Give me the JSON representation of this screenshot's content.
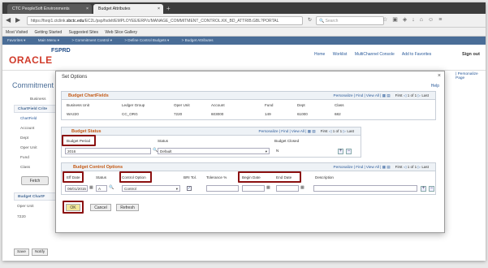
{
  "browser": {
    "tabs": [
      {
        "label": "CTC PeopleSoft Environments"
      },
      {
        "label": "Budget Attributes"
      }
    ],
    "url_prefix": "https://fsrqi1.ctclink.",
    "url_domain": "sbctc.edu",
    "url_suffix": "/EC2L/psp/fsdvlt/EMPLOYEE/ERP/c/MANAGE_COMMITMENT_CONTROL.KK_BD_ATTRIB.GBL?PORTAL",
    "search_placeholder": "Search",
    "bookmarks": [
      "Most Visited",
      "Getting Started",
      "Suggested Sites",
      "Web Slice Gallery"
    ]
  },
  "ps": {
    "menu": [
      "Favorites ▾",
      "Main Menu ▾",
      "> Commitment Control ▾",
      "> Define Control Budgets ▾",
      "> Budget Attributes"
    ],
    "logo": "ORACLE",
    "env": "FSPRD",
    "header_links": [
      "Home",
      "Worklist",
      "MultiChannel Console",
      "Add to Favorites"
    ],
    "signout": "Sign out",
    "new_window": "| Personalize Page",
    "bg_title": "Commitment C",
    "bg_business": "Business",
    "bg_chartfield_criteria": "ChartField Crite",
    "bg_chartfield": "ChartField",
    "bg_labels": [
      "Account",
      "Dept",
      "Oper Unit",
      "Fund",
      "Class"
    ],
    "fetch": "Fetch",
    "bg_budget_chartf": "Budget ChartF",
    "bg_oper_unit": "Oper Unit",
    "bg_oper_val": "7220",
    "bottom_buttons": [
      "Save",
      "Notify"
    ]
  },
  "modal": {
    "title": "Set Options",
    "help": "Help",
    "grid_personalize": "Personalize | Find | View All |",
    "grid_first": "First",
    "grid_last": "Last",
    "grid_count": "1 of 1",
    "chartfields": {
      "title": "Budget ChartFields",
      "headers": [
        "Business Unit",
        "Ledger Group",
        "Oper Unit",
        "Account",
        "Fund",
        "Dept",
        "Class"
      ],
      "values": [
        "WA220",
        "CC_ORG",
        "7220",
        "603000",
        "149",
        "61000",
        "682"
      ]
    },
    "status": {
      "title": "Budget Status",
      "headers": [
        "Budget Period",
        "Status",
        "Budget Closed"
      ],
      "period": "2016",
      "status": "Default",
      "closed": "N"
    },
    "control": {
      "title": "Budget Control Options",
      "headers": [
        "Eff Date",
        "Status",
        "Control Option",
        "BRI Tol.",
        "Tolerance %",
        "Begin Date",
        "End Date",
        "Description"
      ],
      "eff_date": "06/01/2015",
      "status": "A",
      "control_option": "Control",
      "bri_checked": true
    },
    "buttons": {
      "ok": "OK",
      "cancel": "Cancel",
      "refresh": "Refresh"
    }
  },
  "colors": {
    "highlight": "#8b1010",
    "section_title": "#c45a16",
    "ps_nav": "#4a6d97"
  }
}
